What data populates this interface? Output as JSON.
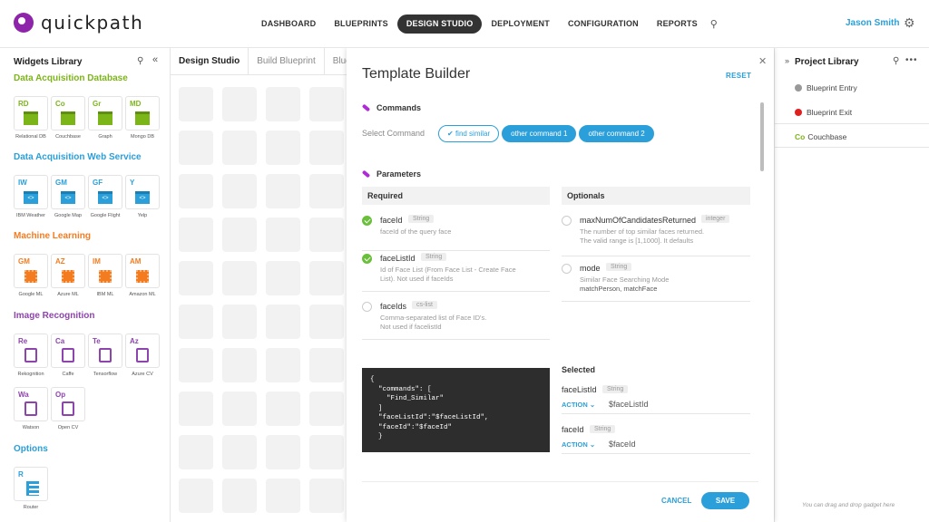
{
  "app": {
    "name": "quickpath"
  },
  "nav": {
    "items": [
      "DASHBOARD",
      "BLUEPRINTS",
      "DESIGN STUDIO",
      "DEPLOYMENT",
      "CONFIGURATION",
      "REPORTS"
    ],
    "active": "DESIGN STUDIO"
  },
  "user": {
    "name": "Jason Smith"
  },
  "widgets_library": {
    "title": "Widgets Library",
    "sections": [
      {
        "title": "Data Acquisition Database",
        "color": "#7cb518",
        "icon": "database-icon",
        "items": [
          {
            "abbr": "RD",
            "label": "Relational DB"
          },
          {
            "abbr": "Co",
            "label": "Couchbase"
          },
          {
            "abbr": "Gr",
            "label": "Graph"
          },
          {
            "abbr": "MD",
            "label": "Mongo DB"
          }
        ]
      },
      {
        "title": "Data Acquisition Web Service",
        "color": "#2b9fd9",
        "icon": "web-service-icon",
        "items": [
          {
            "abbr": "IW",
            "label": "IBM Weather"
          },
          {
            "abbr": "GM",
            "label": "Google Map"
          },
          {
            "abbr": "GF",
            "label": "Google Flight"
          },
          {
            "abbr": "Y",
            "label": "Yelp"
          }
        ]
      },
      {
        "title": "Machine Learning",
        "color": "#f47c20",
        "icon": "chip-icon",
        "items": [
          {
            "abbr": "GM",
            "label": "Google ML"
          },
          {
            "abbr": "AZ",
            "label": "Azure ML"
          },
          {
            "abbr": "IM",
            "label": "IBM ML"
          },
          {
            "abbr": "AM",
            "label": "Amazon ML"
          }
        ]
      },
      {
        "title": "Image Recognition",
        "color": "#8e44ad",
        "icon": "device-icon",
        "items": [
          {
            "abbr": "Re",
            "label": "Rekognition"
          },
          {
            "abbr": "Ca",
            "label": "Caffe"
          },
          {
            "abbr": "Te",
            "label": "Tensorflow"
          },
          {
            "abbr": "Az",
            "label": "Azure CV"
          },
          {
            "abbr": "Wa",
            "label": "Watson"
          },
          {
            "abbr": "Op",
            "label": "Open CV"
          }
        ]
      },
      {
        "title": "Options",
        "color": "#2b9fd9",
        "icon": "router-icon",
        "items": [
          {
            "abbr": "R",
            "label": "Router"
          }
        ]
      }
    ]
  },
  "canvas": {
    "tabs": [
      "Design Studio",
      "Build Blueprint",
      "Blue"
    ],
    "active_tab": "Design Studio"
  },
  "modal": {
    "title": "Template Builder",
    "reset": "RESET",
    "commands_title": "Commands",
    "select_command_label": "Select Command",
    "commands": [
      {
        "label": "find similar",
        "selected": true
      },
      {
        "label": "other command 1",
        "selected": false
      },
      {
        "label": "other command 2",
        "selected": false
      }
    ],
    "parameters_title": "Parameters",
    "required_title": "Required",
    "optionals_title": "Optionals",
    "required": [
      {
        "name": "faceId",
        "type": "String",
        "desc": [
          "faceId of the query face"
        ],
        "checked": true
      },
      {
        "name": "faceListId",
        "type": "String",
        "desc": [
          "Id of Face List (From Face List - Create Face",
          "List). Not used if faceIds"
        ],
        "checked": true
      },
      {
        "name": "faceIds",
        "type": "cs-list",
        "desc": [
          "Comma-separated list of Face ID's.",
          "Not used if facelistId"
        ],
        "checked": false
      }
    ],
    "optionals": [
      {
        "name": "maxNumOfCandidatesReturned",
        "type": "integer",
        "desc": [
          "The number of top similar faces returned.",
          "The valid range is [1,1000]. It defaults"
        ],
        "checked": false
      },
      {
        "name": "mode",
        "type": "String",
        "desc": [
          "Similar Face Searching Mode",
          "matchPerson, matchFace"
        ],
        "checked": false
      }
    ],
    "code": "{\n  \"commands\": [\n    \"Find_Similar\"\n  ]\n  \"faceListId\":\"$faceListId\",\n  \"faceId\":\"$faceId\"\n  }",
    "selected_title": "Selected",
    "selected": [
      {
        "name": "faceListId",
        "type": "String",
        "action": "ACTION",
        "value": "$faceListId"
      },
      {
        "name": "faceId",
        "type": "String",
        "action": "ACTION",
        "value": "$faceId"
      }
    ],
    "cancel": "CANCEL",
    "save": "SAVE"
  },
  "project_library": {
    "title": "Project Library",
    "items": [
      {
        "label": "Blueprint Entry",
        "color": "#999999"
      },
      {
        "label": "Blueprint Exit",
        "color": "#e02020"
      }
    ],
    "couchbase": {
      "abbr": "Co",
      "label": "Couchbase"
    },
    "hint": "You can drag and drop gadget here"
  },
  "colors": {
    "accent": "#2b9fd9",
    "brand": "#8e24aa"
  }
}
